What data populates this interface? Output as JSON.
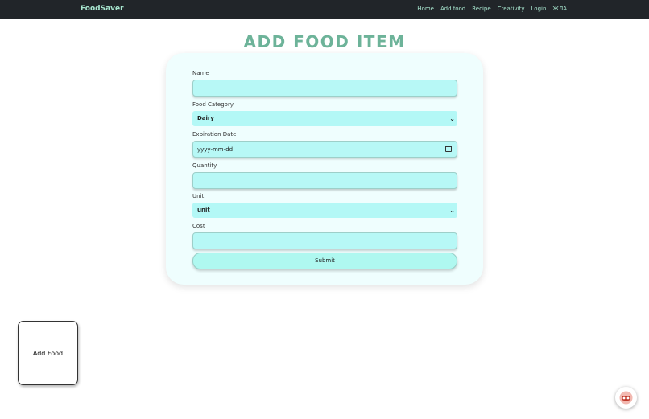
{
  "nav": {
    "brand": "FoodSaver",
    "links": [
      "Home",
      "Add food",
      "Recipe",
      "Creativity",
      "Login",
      "ЖЛА"
    ]
  },
  "page": {
    "title": "ADD FOOD ITEM"
  },
  "form": {
    "name_label": "Name",
    "name_value": "",
    "category_label": "Food Category",
    "category_value": "Dairy",
    "expiration_label": "Expiration Date",
    "expiration_placeholder": "yyyy-mm-dd",
    "quantity_label": "Quantity",
    "quantity_value": "",
    "unit_label": "Unit",
    "unit_value": "unit",
    "cost_label": "Cost",
    "cost_value": "",
    "submit_label": "Submit"
  },
  "card": {
    "label": "Add Food"
  },
  "icons": {
    "chevron": "chevron-down-icon",
    "calendar": "calendar-icon",
    "chat": "chat-bot-icon"
  },
  "colors": {
    "navbar": "#212529",
    "accent": "#a8e6cf",
    "title": "#6db399",
    "field": "#b7f8f6"
  }
}
